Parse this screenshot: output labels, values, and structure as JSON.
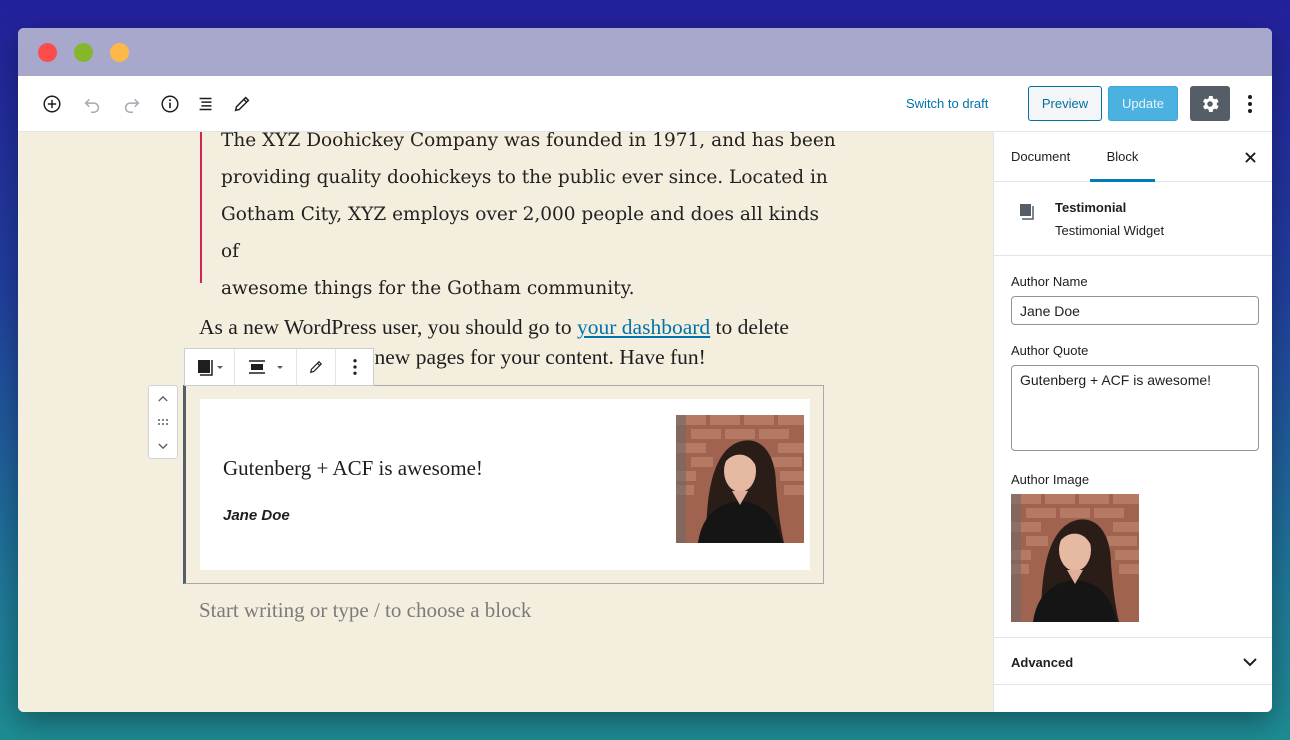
{
  "toolbar": {
    "switch_draft_label": "Switch to draft",
    "preview_label": "Preview",
    "update_label": "Update",
    "icons": [
      "add-block-icon",
      "undo-icon",
      "redo-icon",
      "info-icon",
      "outline-icon",
      "edit-icon",
      "gear-icon",
      "more-vertical-icon"
    ]
  },
  "editor": {
    "quote_lines": [
      "The XYZ Doohickey Company was founded in 1971, and has been",
      "providing quality doohickeys to the public ever since. Located in",
      "Gotham City, XYZ employs over 2,000 people and does all kinds of",
      "awesome things for the Gotham community."
    ],
    "para_before": "As a new WordPress user, you should go to ",
    "para_link": "your dashboard",
    "para_after": " to delete",
    "para_line2": "this page and create new pages for your content. Have fun!",
    "testimonial": {
      "quote": "Gutenberg + ACF is awesome!",
      "author": "Jane Doe"
    },
    "placeholder": "Start writing or type / to choose a block"
  },
  "sidebar": {
    "tabs": [
      {
        "label": "Document"
      },
      {
        "label": "Block"
      }
    ],
    "active_tab": "Block",
    "block_title": "Testimonial",
    "block_desc": "Testimonial Widget",
    "author_name_label": "Author Name",
    "author_name_value": "Jane Doe",
    "author_quote_label": "Author Quote",
    "author_quote_value": "Gutenberg + ACF is awesome!",
    "author_image_label": "Author Image",
    "advanced_label": "Advanced"
  },
  "colors": {
    "accent": "#007cba",
    "link": "#0073aa",
    "quote_border": "#cd2653",
    "editor_bg": "#f4eedf"
  }
}
